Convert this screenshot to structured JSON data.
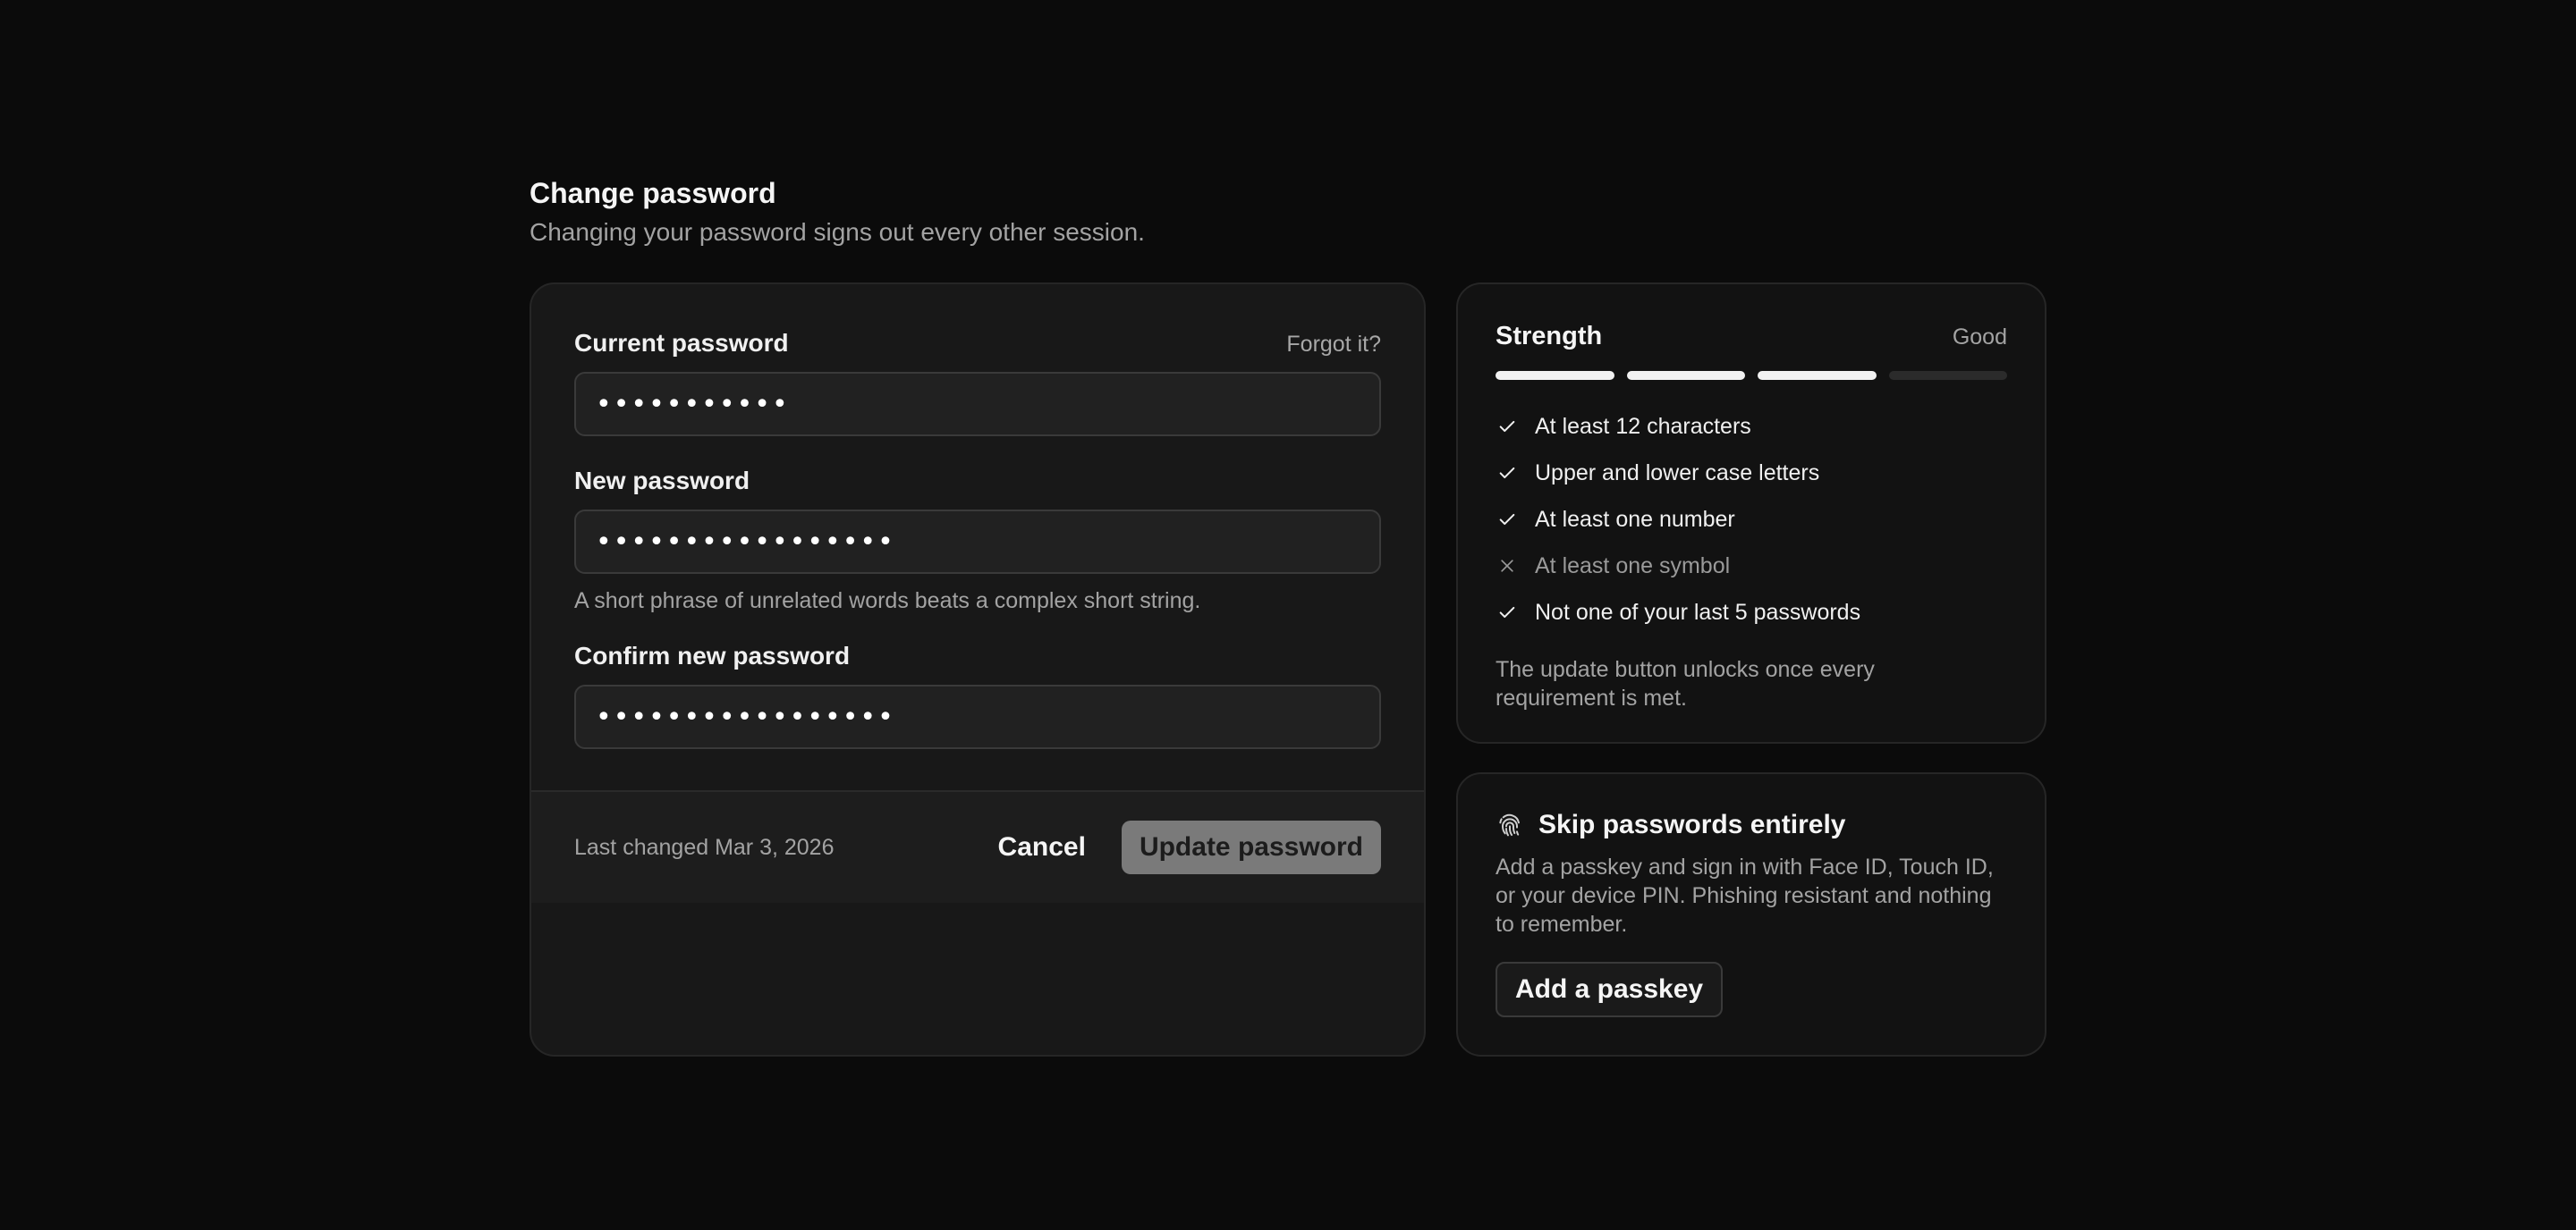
{
  "header": {
    "title": "Change password",
    "subtitle": "Changing your password signs out every other session."
  },
  "form": {
    "current": {
      "label": "Current password",
      "forgot_link": "Forgot it?",
      "value": "•••••••••••"
    },
    "new": {
      "label": "New password",
      "value": "•••••••••••••••••",
      "hint": "A short phrase of unrelated words beats a complex short string."
    },
    "confirm": {
      "label": "Confirm new password",
      "value": "•••••••••••••••••"
    },
    "footer": {
      "last_changed": "Last changed Mar 3, 2026",
      "cancel_label": "Cancel",
      "update_label": "Update password"
    }
  },
  "strength": {
    "title": "Strength",
    "rating": "Good",
    "segments_filled": 3,
    "segments_total": 4,
    "requirements": [
      {
        "label": "At least 12 characters",
        "met": true
      },
      {
        "label": "Upper and lower case letters",
        "met": true
      },
      {
        "label": "At least one number",
        "met": true
      },
      {
        "label": "At least one symbol",
        "met": false
      },
      {
        "label": "Not one of your last 5 passwords",
        "met": true
      }
    ],
    "note": "The update button unlocks once every requirement is met."
  },
  "passkey": {
    "icon": "fingerprint-icon",
    "title": "Skip passwords entirely",
    "description": "Add a passkey and sign in with Face ID, Touch ID, or your device PIN. Phishing resistant and nothing to remember.",
    "button_label": "Add a passkey"
  },
  "colors": {
    "background": "#0b0b0b",
    "card": "#181818",
    "accent_text": "#f5f5f5",
    "muted_text": "#a3a3a3",
    "disabled_button": "#7a7a7a"
  }
}
